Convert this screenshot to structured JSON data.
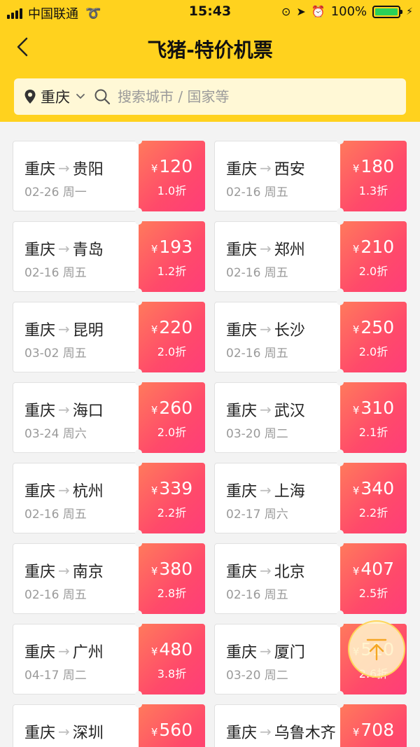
{
  "status_bar": {
    "carrier": "中国联通",
    "time": "15:43",
    "battery_percent": "100%",
    "battery_level": 1.0,
    "battery_color": "#2bd158"
  },
  "header": {
    "title": "飞猪-特价机票",
    "background": "#ffd21e"
  },
  "search": {
    "city": "重庆",
    "placeholder": "搜索城市 / 国家等"
  },
  "deals": [
    {
      "from": "重庆",
      "to": "贵阳",
      "date": "02-26 周一",
      "price": "120",
      "discount": "1.0折"
    },
    {
      "from": "重庆",
      "to": "西安",
      "date": "02-16 周五",
      "price": "180",
      "discount": "1.3折"
    },
    {
      "from": "重庆",
      "to": "青岛",
      "date": "02-16 周五",
      "price": "193",
      "discount": "1.2折"
    },
    {
      "from": "重庆",
      "to": "郑州",
      "date": "02-16 周五",
      "price": "210",
      "discount": "2.0折"
    },
    {
      "from": "重庆",
      "to": "昆明",
      "date": "03-02 周五",
      "price": "220",
      "discount": "2.0折"
    },
    {
      "from": "重庆",
      "to": "长沙",
      "date": "02-16 周五",
      "price": "250",
      "discount": "2.0折"
    },
    {
      "from": "重庆",
      "to": "海口",
      "date": "03-24 周六",
      "price": "260",
      "discount": "2.0折"
    },
    {
      "from": "重庆",
      "to": "武汉",
      "date": "03-20 周二",
      "price": "310",
      "discount": "2.1折"
    },
    {
      "from": "重庆",
      "to": "杭州",
      "date": "02-16 周五",
      "price": "339",
      "discount": "2.2折"
    },
    {
      "from": "重庆",
      "to": "上海",
      "date": "02-17 周六",
      "price": "340",
      "discount": "2.2折"
    },
    {
      "from": "重庆",
      "to": "南京",
      "date": "02-16 周五",
      "price": "380",
      "discount": "2.8折"
    },
    {
      "from": "重庆",
      "to": "北京",
      "date": "02-16 周五",
      "price": "407",
      "discount": "2.5折"
    },
    {
      "from": "重庆",
      "to": "广州",
      "date": "04-17 周二",
      "price": "480",
      "discount": "3.8折"
    },
    {
      "from": "重庆",
      "to": "厦门",
      "date": "03-20 周二",
      "price": "510",
      "discount": "2.6折"
    },
    {
      "from": "重庆",
      "to": "深圳",
      "date": "",
      "price": "560",
      "discount": ""
    },
    {
      "from": "重庆",
      "to": "乌鲁木齐",
      "date": "",
      "price": "708",
      "discount": ""
    }
  ],
  "currency_symbol": "¥",
  "route_arrow": "→",
  "accent_gradient": [
    "#ff7a5c",
    "#ff3d79"
  ]
}
